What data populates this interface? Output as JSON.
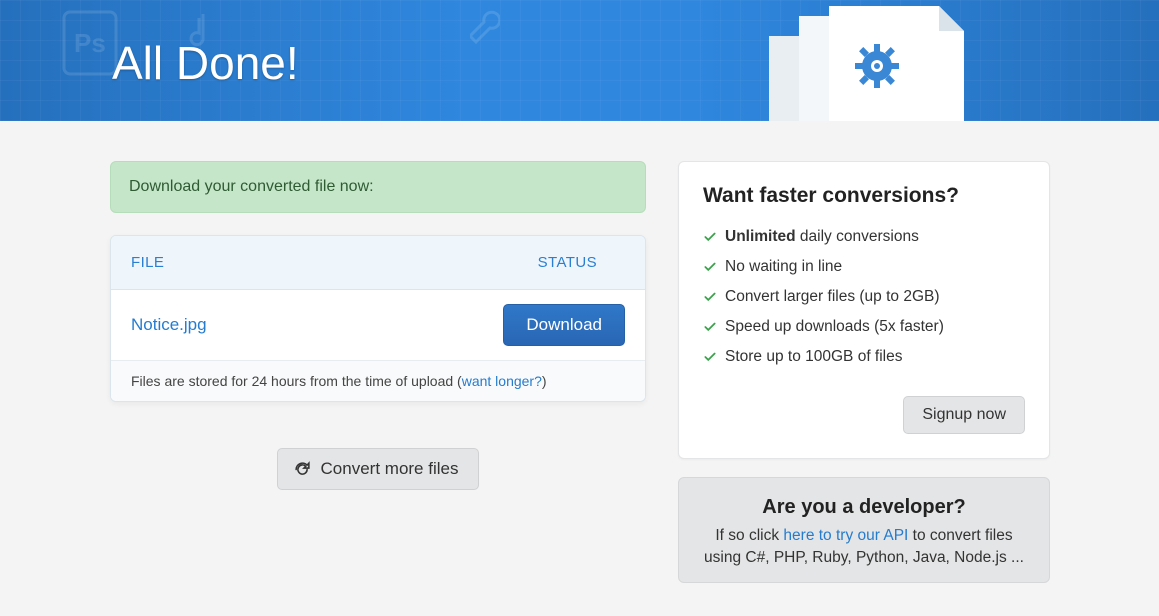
{
  "hero": {
    "title": "All Done!"
  },
  "alert": {
    "text": "Download your converted file now:"
  },
  "table": {
    "headers": {
      "file": "FILE",
      "status": "STATUS"
    },
    "rows": [
      {
        "filename": "Notice.jpg",
        "action_label": "Download"
      }
    ],
    "footer": {
      "prefix": "Files are stored for 24 hours from the time of upload (",
      "link": "want longer?",
      "suffix": ")"
    }
  },
  "convert_more": {
    "label": "Convert more files"
  },
  "upsell": {
    "title": "Want faster conversions?",
    "features": [
      {
        "bold": "Unlimited",
        "rest": " daily conversions"
      },
      {
        "bold": "",
        "rest": "No waiting in line"
      },
      {
        "bold": "",
        "rest": "Convert larger files (up to 2GB)"
      },
      {
        "bold": "",
        "rest": "Speed up downloads (5x faster)"
      },
      {
        "bold": "",
        "rest": "Store up to 100GB of files"
      }
    ],
    "signup_label": "Signup now"
  },
  "developer": {
    "title": "Are you a developer?",
    "prefix": "If so click ",
    "link": "here to try our API",
    "suffix": " to convert files using C#, PHP, Ruby, Python, Java, Node.js ..."
  }
}
